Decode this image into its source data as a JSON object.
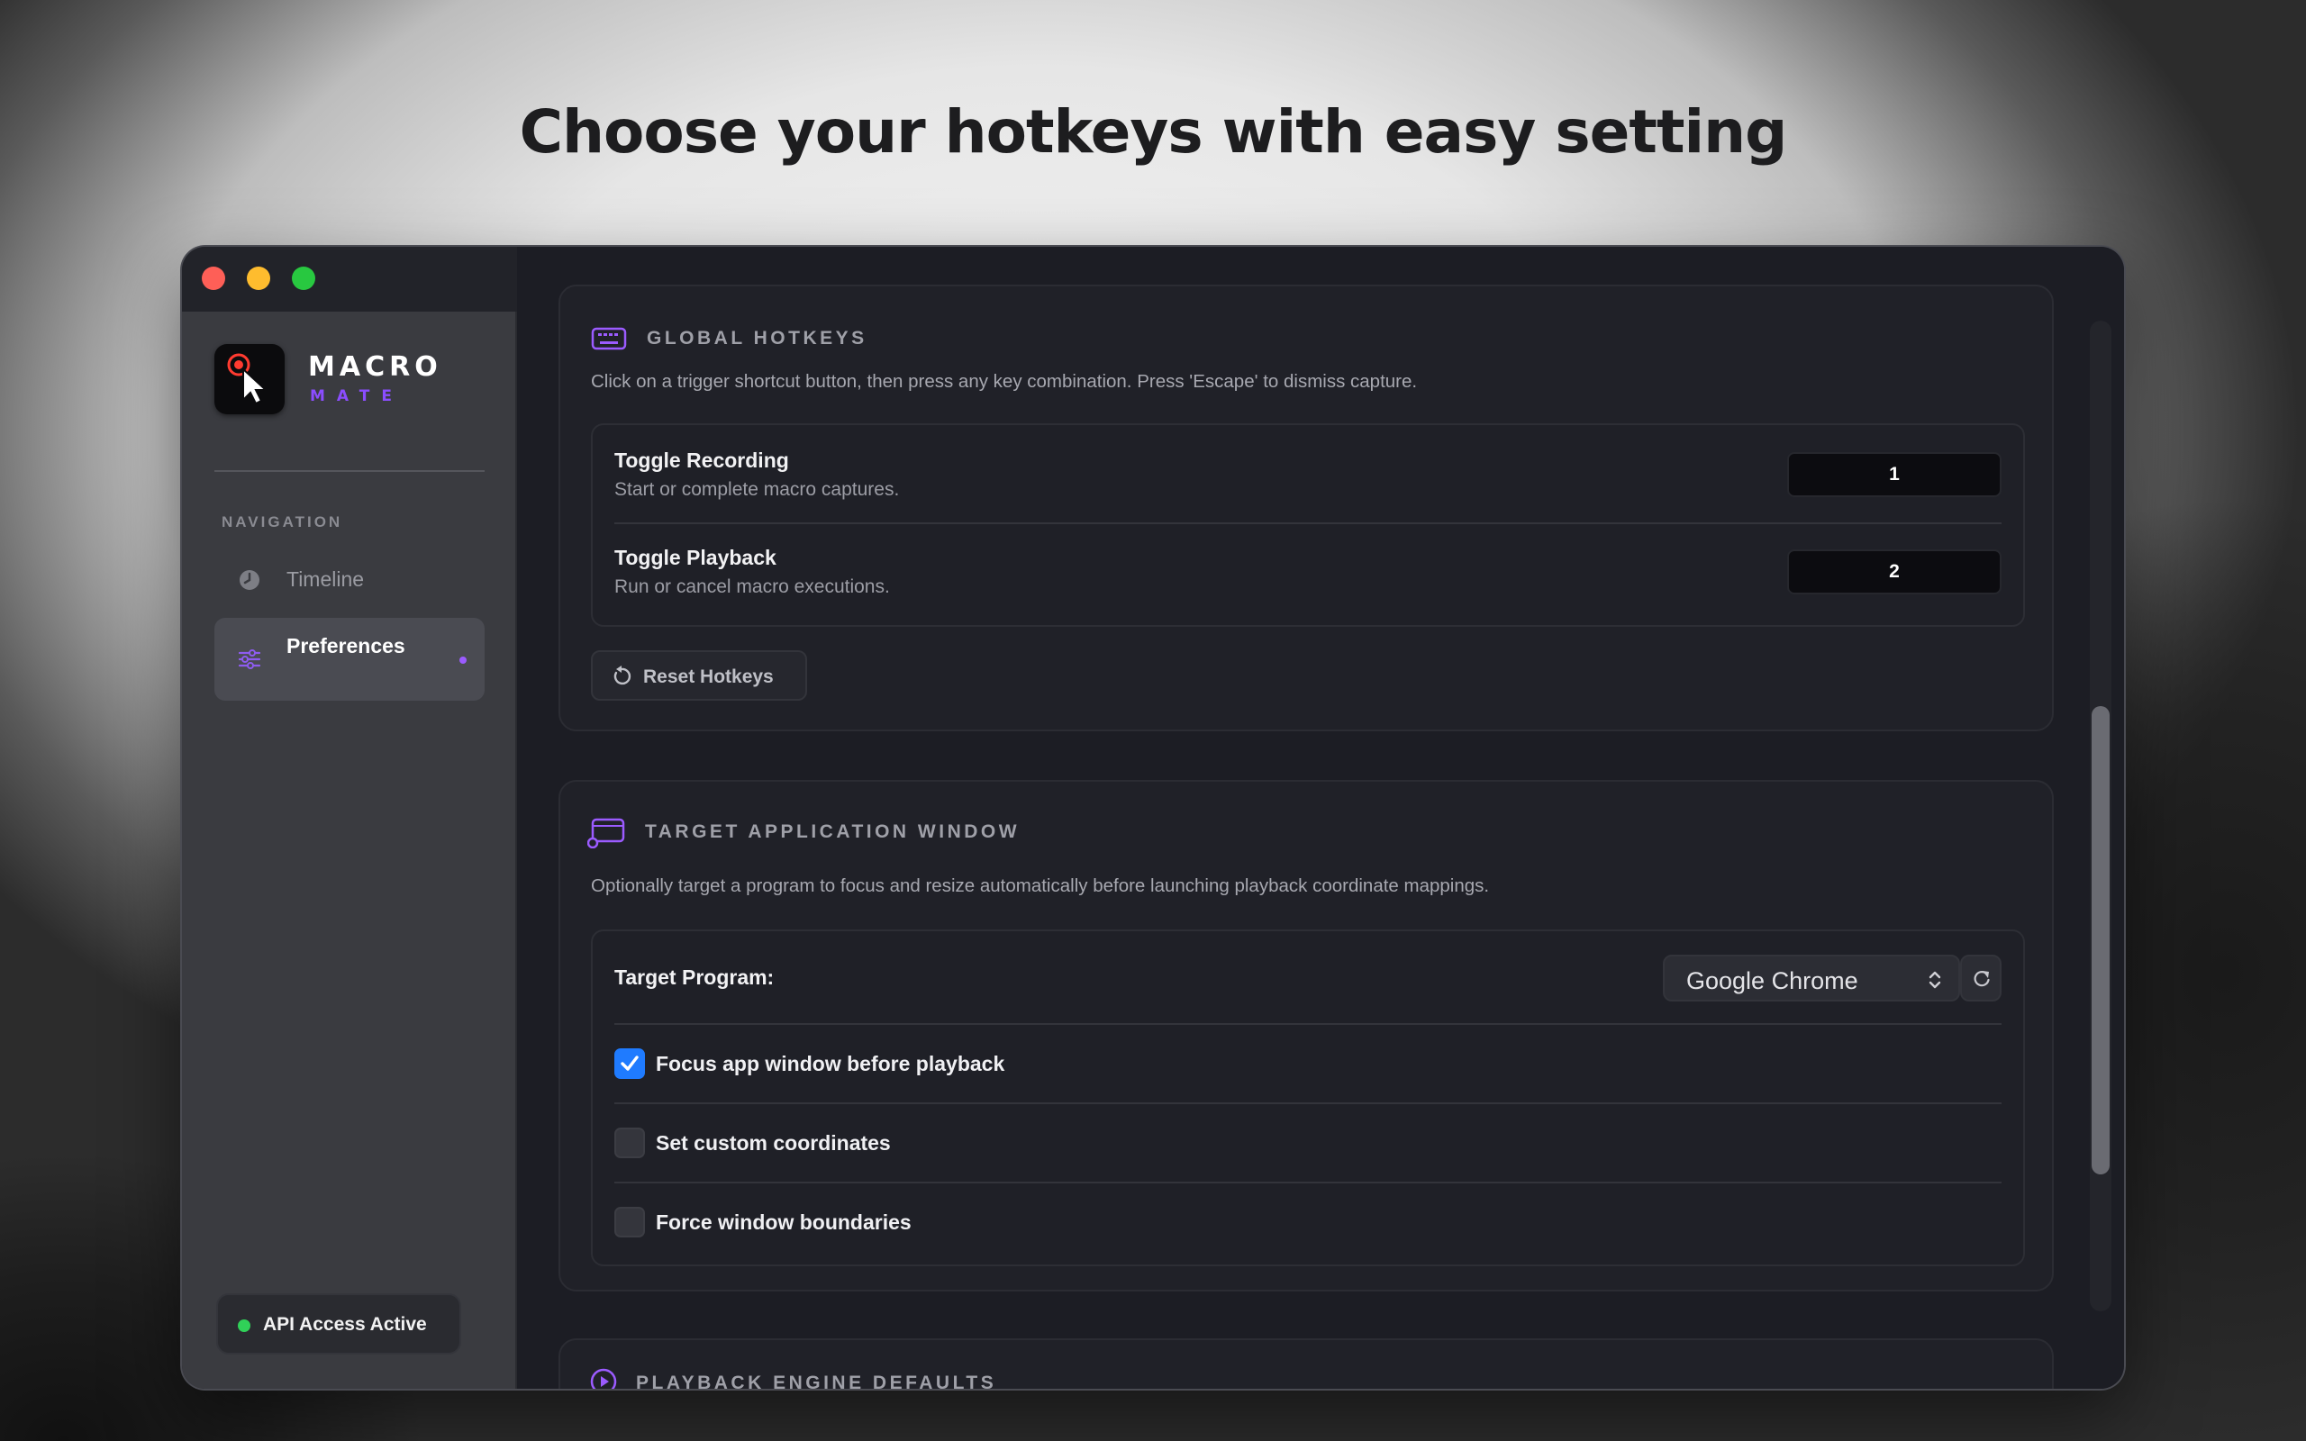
{
  "headline": "Choose your hotkeys with easy setting",
  "app": {
    "logo_line1": "MACRO",
    "logo_line2": "MATE",
    "accent_color": "#8b4dff"
  },
  "sidebar": {
    "section_label": "NAVIGATION",
    "items": [
      {
        "label": "Timeline",
        "icon": "clock-icon",
        "active": false
      },
      {
        "label": "Preferences",
        "icon": "sliders-icon",
        "active": true
      }
    ],
    "status": {
      "label": "API Access Active",
      "color": "#30d158"
    }
  },
  "hotkeys": {
    "title": "GLOBAL HOTKEYS",
    "icon": "keyboard-icon",
    "description": "Click on a trigger shortcut button, then press any key combination. Press 'Escape' to dismiss capture.",
    "rows": [
      {
        "title": "Toggle Recording",
        "subtitle": "Start or complete macro captures.",
        "key": "1"
      },
      {
        "title": "Toggle Playback",
        "subtitle": "Run or cancel macro executions.",
        "key": "2"
      }
    ],
    "reset_label": "Reset Hotkeys"
  },
  "target": {
    "title": "TARGET APPLICATION WINDOW",
    "icon": "window-icon",
    "description": "Optionally target a program to focus and resize automatically before launching playback coordinate mappings.",
    "program_label": "Target Program:",
    "program_value": "Google Chrome",
    "options": [
      {
        "label": "Focus app window before playback",
        "checked": true
      },
      {
        "label": "Set custom coordinates",
        "checked": false
      },
      {
        "label": "Force window boundaries",
        "checked": false
      }
    ]
  },
  "playback": {
    "title": "PLAYBACK ENGINE DEFAULTS",
    "icon": "play-circle-icon"
  }
}
